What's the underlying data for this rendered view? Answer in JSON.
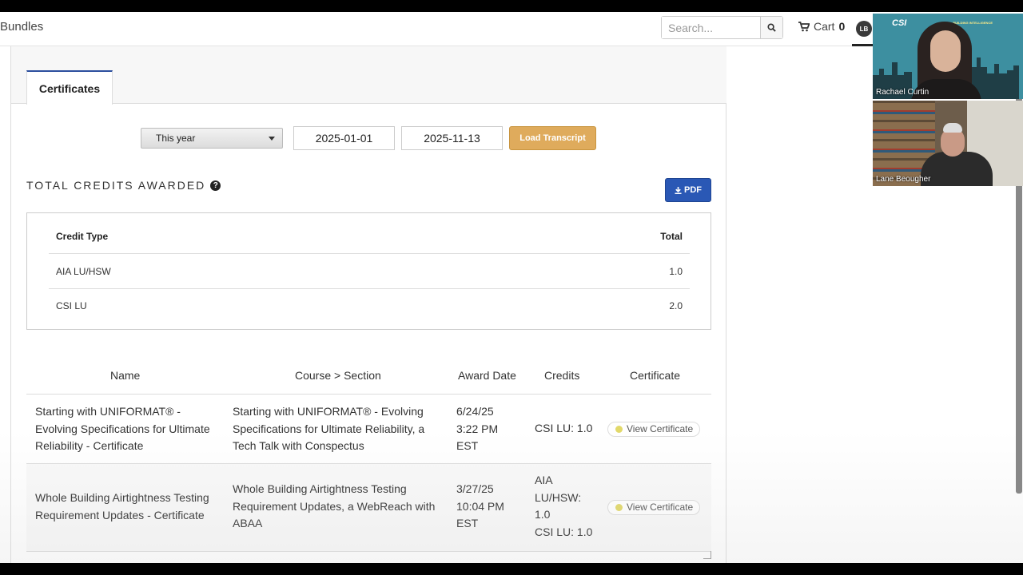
{
  "nav": {
    "bundles_label": "Bundles",
    "search_placeholder": "Search...",
    "cart_label": "Cart",
    "cart_count": "0",
    "avatar_initials": "LB"
  },
  "tabs": [
    {
      "label": "Certificates",
      "active": true
    }
  ],
  "filter": {
    "range_selected": "This year",
    "start_date": "2025-01-01",
    "end_date": "2025-11-13",
    "load_label": "Load Transcript"
  },
  "totals": {
    "heading": "TOTAL CREDITS AWARDED",
    "pdf_label": "PDF",
    "columns": [
      "Credit Type",
      "Total"
    ],
    "rows": [
      {
        "type": "AIA LU/HSW",
        "total": "1.0"
      },
      {
        "type": "CSI LU",
        "total": "2.0"
      }
    ]
  },
  "certificates": {
    "columns": [
      "Name",
      "Course > Section",
      "Award Date",
      "Credits",
      "Certificate"
    ],
    "rows": [
      {
        "name": "Starting with UNIFORMAT® - Evolving Specifications for Ultimate Reliability - Certificate",
        "course": "Starting with UNIFORMAT® - Evolving Specifications for Ultimate Reliability, a Tech Talk with Conspectus",
        "date_line1": "6/24/25",
        "date_line2": "3:22 PM",
        "date_line3": "EST",
        "credits_line1": "CSI LU: 1.0",
        "action": "View Certificate"
      },
      {
        "name": "Whole Building Airtightness Testing Requirement Updates - Certificate",
        "course": "Whole Building Airtightness Testing Requirement Updates, a WebReach with ABAA",
        "date_line1": "3/27/25",
        "date_line2": "10:04 PM",
        "date_line3": "EST",
        "credits_line1": "AIA",
        "credits_line2": "LU/HSW:",
        "credits_line3": "1.0",
        "credits_line4": "CSI LU: 1.0",
        "action": "View Certificate"
      }
    ]
  },
  "video": {
    "participant1": "Rachael Curtin",
    "participant2": "Lane Beougher",
    "logo_text": "CSI",
    "logo_sub": "BUILDING INTELLIGENCE"
  },
  "colors": {
    "load_button": "#dfab5c",
    "pdf_button": "#2a58b5",
    "tab_accent": "#2c4f9e",
    "status_dot": "#e2d96a"
  },
  "icons": [
    "search-icon",
    "cart-icon",
    "caret-down-icon",
    "help-icon",
    "download-icon",
    "status-dot-icon"
  ]
}
